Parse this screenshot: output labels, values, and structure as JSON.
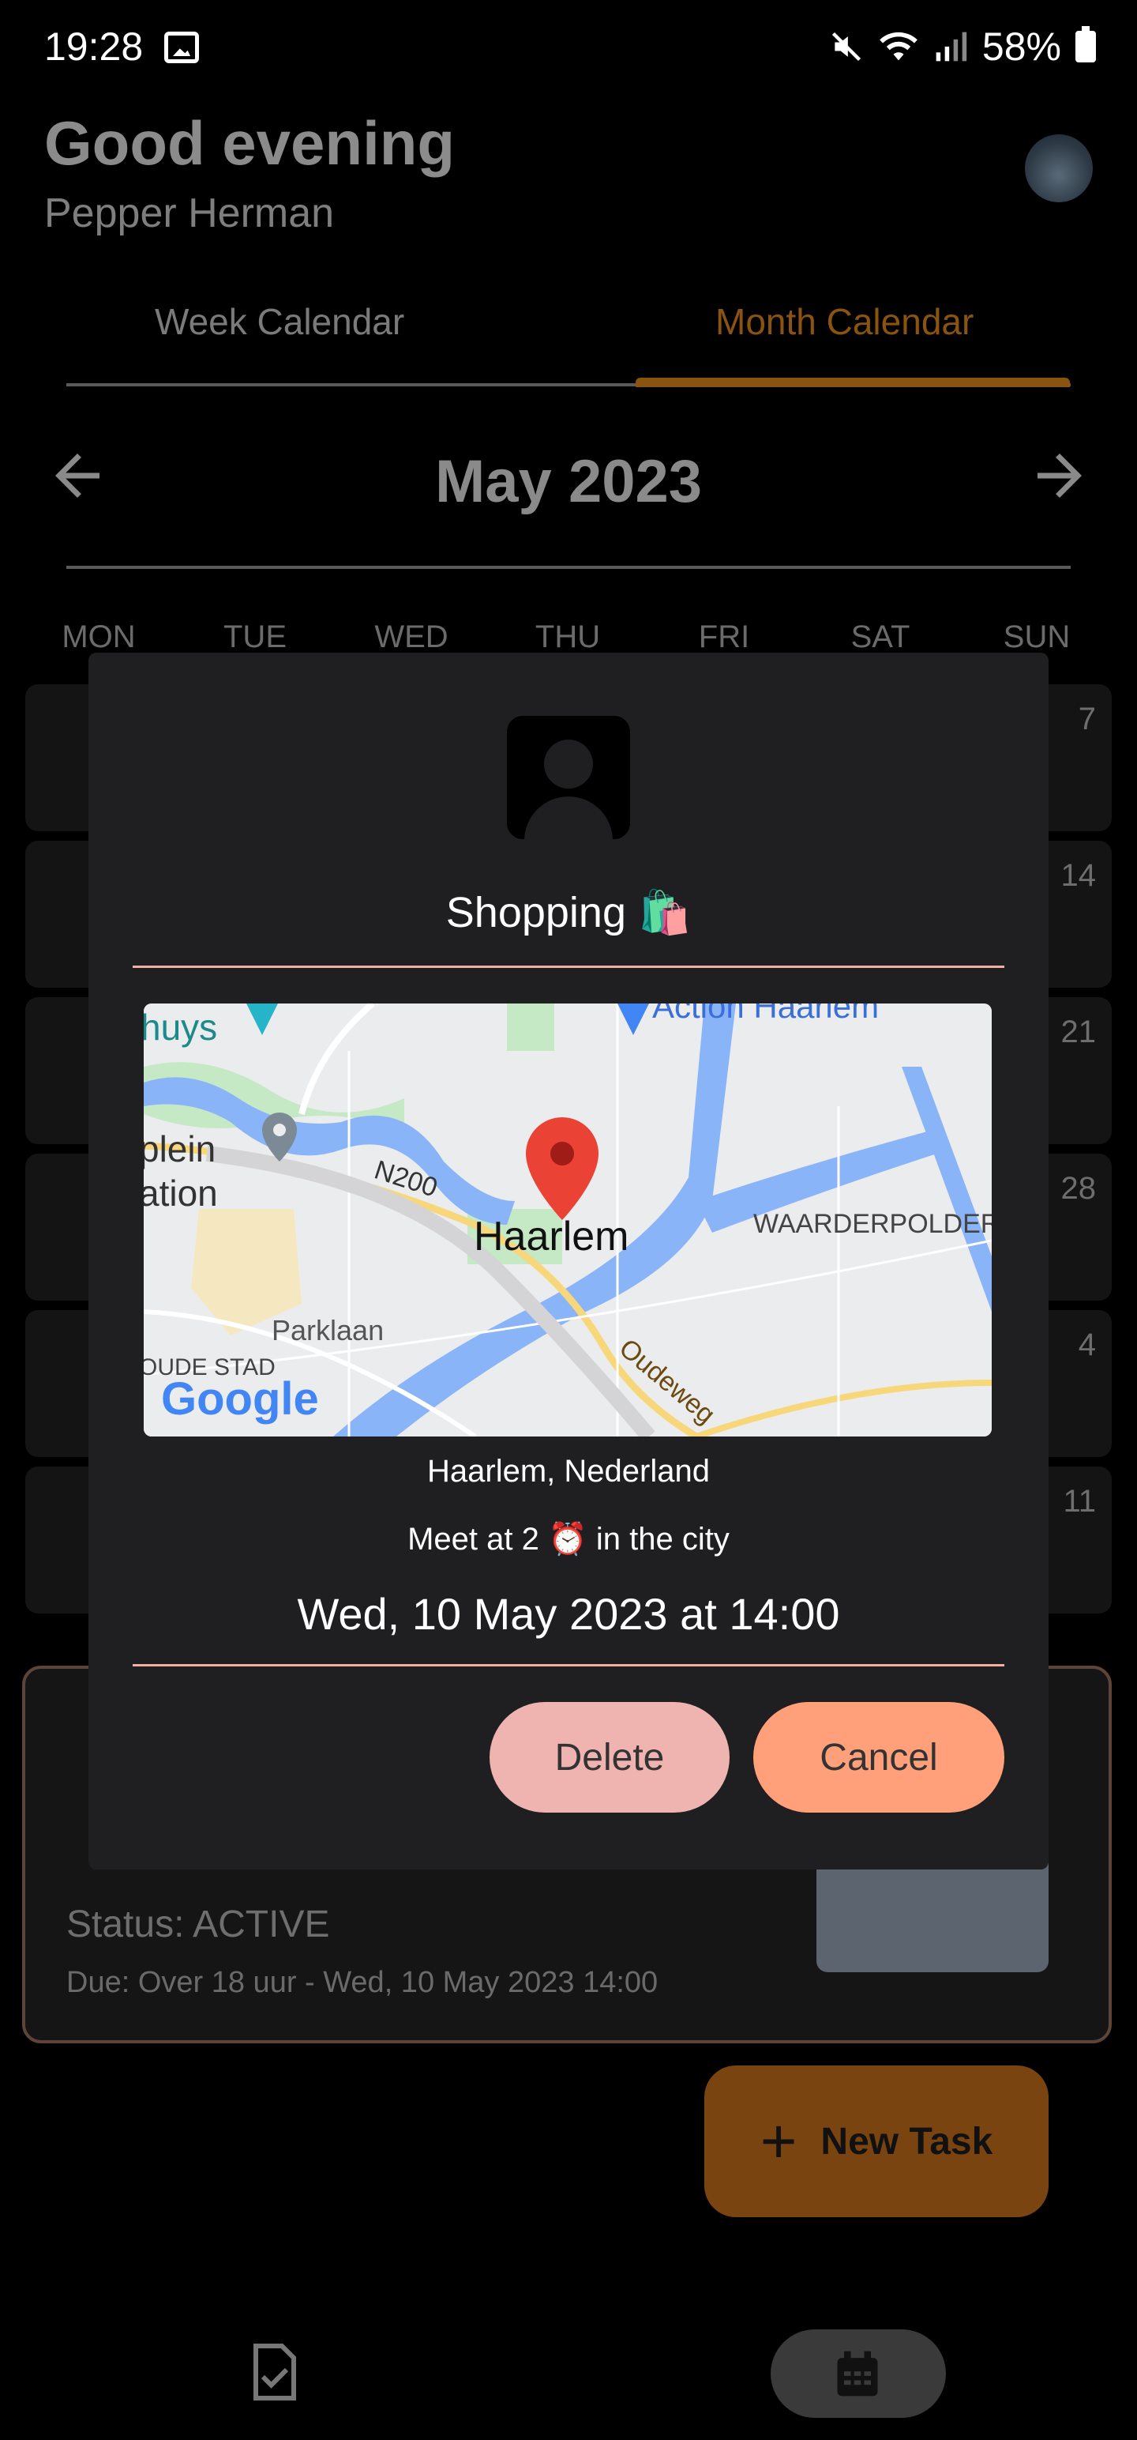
{
  "status_bar": {
    "time": "19:28",
    "battery": "58%"
  },
  "header": {
    "greeting": "Good evening",
    "user_name": "Pepper Herman"
  },
  "tabs": [
    {
      "label": "Week Calendar",
      "active": false
    },
    {
      "label": "Month Calendar",
      "active": true
    }
  ],
  "calendar": {
    "month_title": "May 2023",
    "weekdays": [
      "MON",
      "TUE",
      "WED",
      "THU",
      "FRI",
      "SAT",
      "SUN"
    ],
    "week_end_days": [
      "7",
      "14",
      "21",
      "28",
      "4",
      "11"
    ]
  },
  "task_card": {
    "status": "Status: ACTIVE",
    "due": "Due: Over 18 uur - Wed, 10 May 2023 14:00"
  },
  "fab": {
    "label": "New Task"
  },
  "dialog": {
    "title": "Shopping 🛍️",
    "map_labels": {
      "place": "Haarlem",
      "poi": "Action Haarlem",
      "road1": "N200",
      "road2": "Parklaan",
      "road3": "Oudeweg",
      "district1": "WAARDERPOLDER",
      "district2": "OUDE STAD",
      "frag_huys": "huys",
      "frag_plein": "plein",
      "frag_ation": "ation",
      "brand": "Google"
    },
    "location": "Haarlem, Nederland",
    "description": "Meet at 2 ⏰ in the city",
    "datetime": "Wed, 10 May 2023 at 14:00",
    "delete_label": "Delete",
    "cancel_label": "Cancel"
  },
  "colors": {
    "accent": "#ffa07a",
    "delete": "#f0b4b0",
    "divider": "#f2b1a0",
    "month_tab": "#8a5310"
  }
}
